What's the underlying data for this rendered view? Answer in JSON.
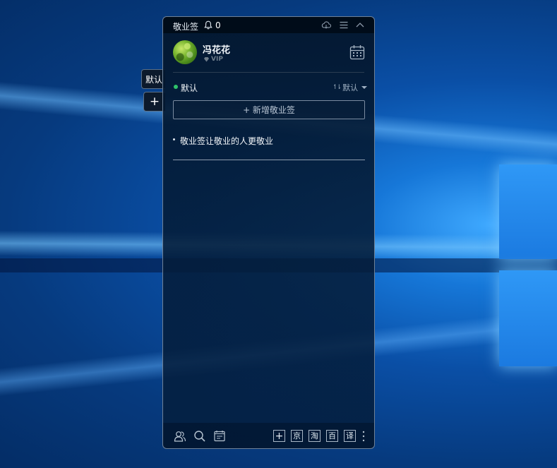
{
  "side_tabs": {
    "default_tab": "默认",
    "add_tab": "+"
  },
  "app": {
    "title": "敬业签",
    "notification_count": "0"
  },
  "user": {
    "name": "冯花花",
    "badge": "VIP"
  },
  "category": {
    "name": "默认",
    "sort_label": "默认",
    "sort_icon": "↿⇂"
  },
  "add_note_label": "+ 新增敬业签",
  "notes": [
    {
      "text": "敬业签让敬业的人更敬业"
    }
  ],
  "bottom_buttons": {
    "add": "+",
    "jd": "京",
    "taobao": "淘",
    "baidu": "百",
    "translate": "译"
  },
  "colors": {
    "category_dot": "#2ec26a",
    "panel_bg": "#04203e",
    "border": "#6f8196"
  }
}
